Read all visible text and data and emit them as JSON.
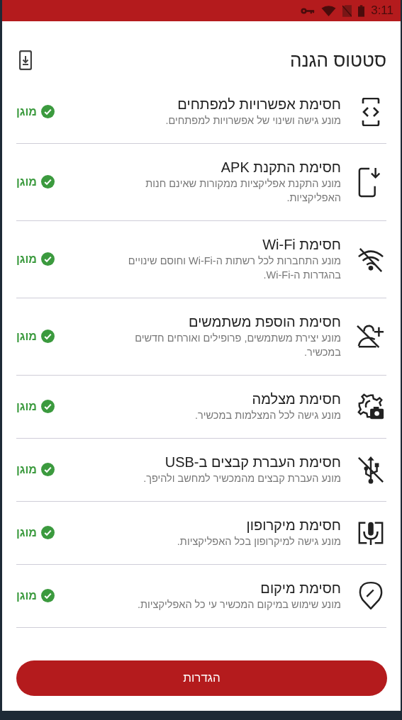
{
  "status_bar": {
    "time": "3:11"
  },
  "header": {
    "title": "סטטוס הגנה"
  },
  "items": [
    {
      "title": "חסימת אפשרויות למפתחים",
      "description": "מונע גישה ושינוי של אפשרויות למפתחים.",
      "status": "מוגן",
      "protected": true
    },
    {
      "title": "חסימת התקנת APK",
      "description": "מונע התקנת אפליקציות ממקורות שאינם חנות האפליקציות.",
      "status": "מוגן",
      "protected": true
    },
    {
      "title": "חסימת Wi-Fi",
      "description": "מונע התחברות לכל רשתות ה-Wi-Fi וחוסם שינויים בהגדרות ה-Wi-Fi.",
      "status": "מוגן",
      "protected": true
    },
    {
      "title": "חסימת הוספת משתמשים",
      "description": "מונע יצירת משתמשים, פרופילים ואורחים חדשים במכשיר.",
      "status": "מוגן",
      "protected": true
    },
    {
      "title": "חסימת מצלמה",
      "description": "מונע גישה לכל המצלמות במכשיר.",
      "status": "מוגן",
      "protected": true
    },
    {
      "title": "חסימת העברת קבצים ב-USB",
      "description": "מונע העברת קבצים מהמכשיר למחשב ולהיפך.",
      "status": "מוגן",
      "protected": true
    },
    {
      "title": "חסימת מיקרופון",
      "description": "מונע גישה למיקרופון בכל האפליקציות.",
      "status": "מוגן",
      "protected": true
    },
    {
      "title": "חסימת מיקום",
      "description": "מונע שימוש במיקום המכשיר עי כל האפליקציות.",
      "status": "מוגן",
      "protected": true
    }
  ],
  "button": {
    "label": "הגדרות"
  }
}
